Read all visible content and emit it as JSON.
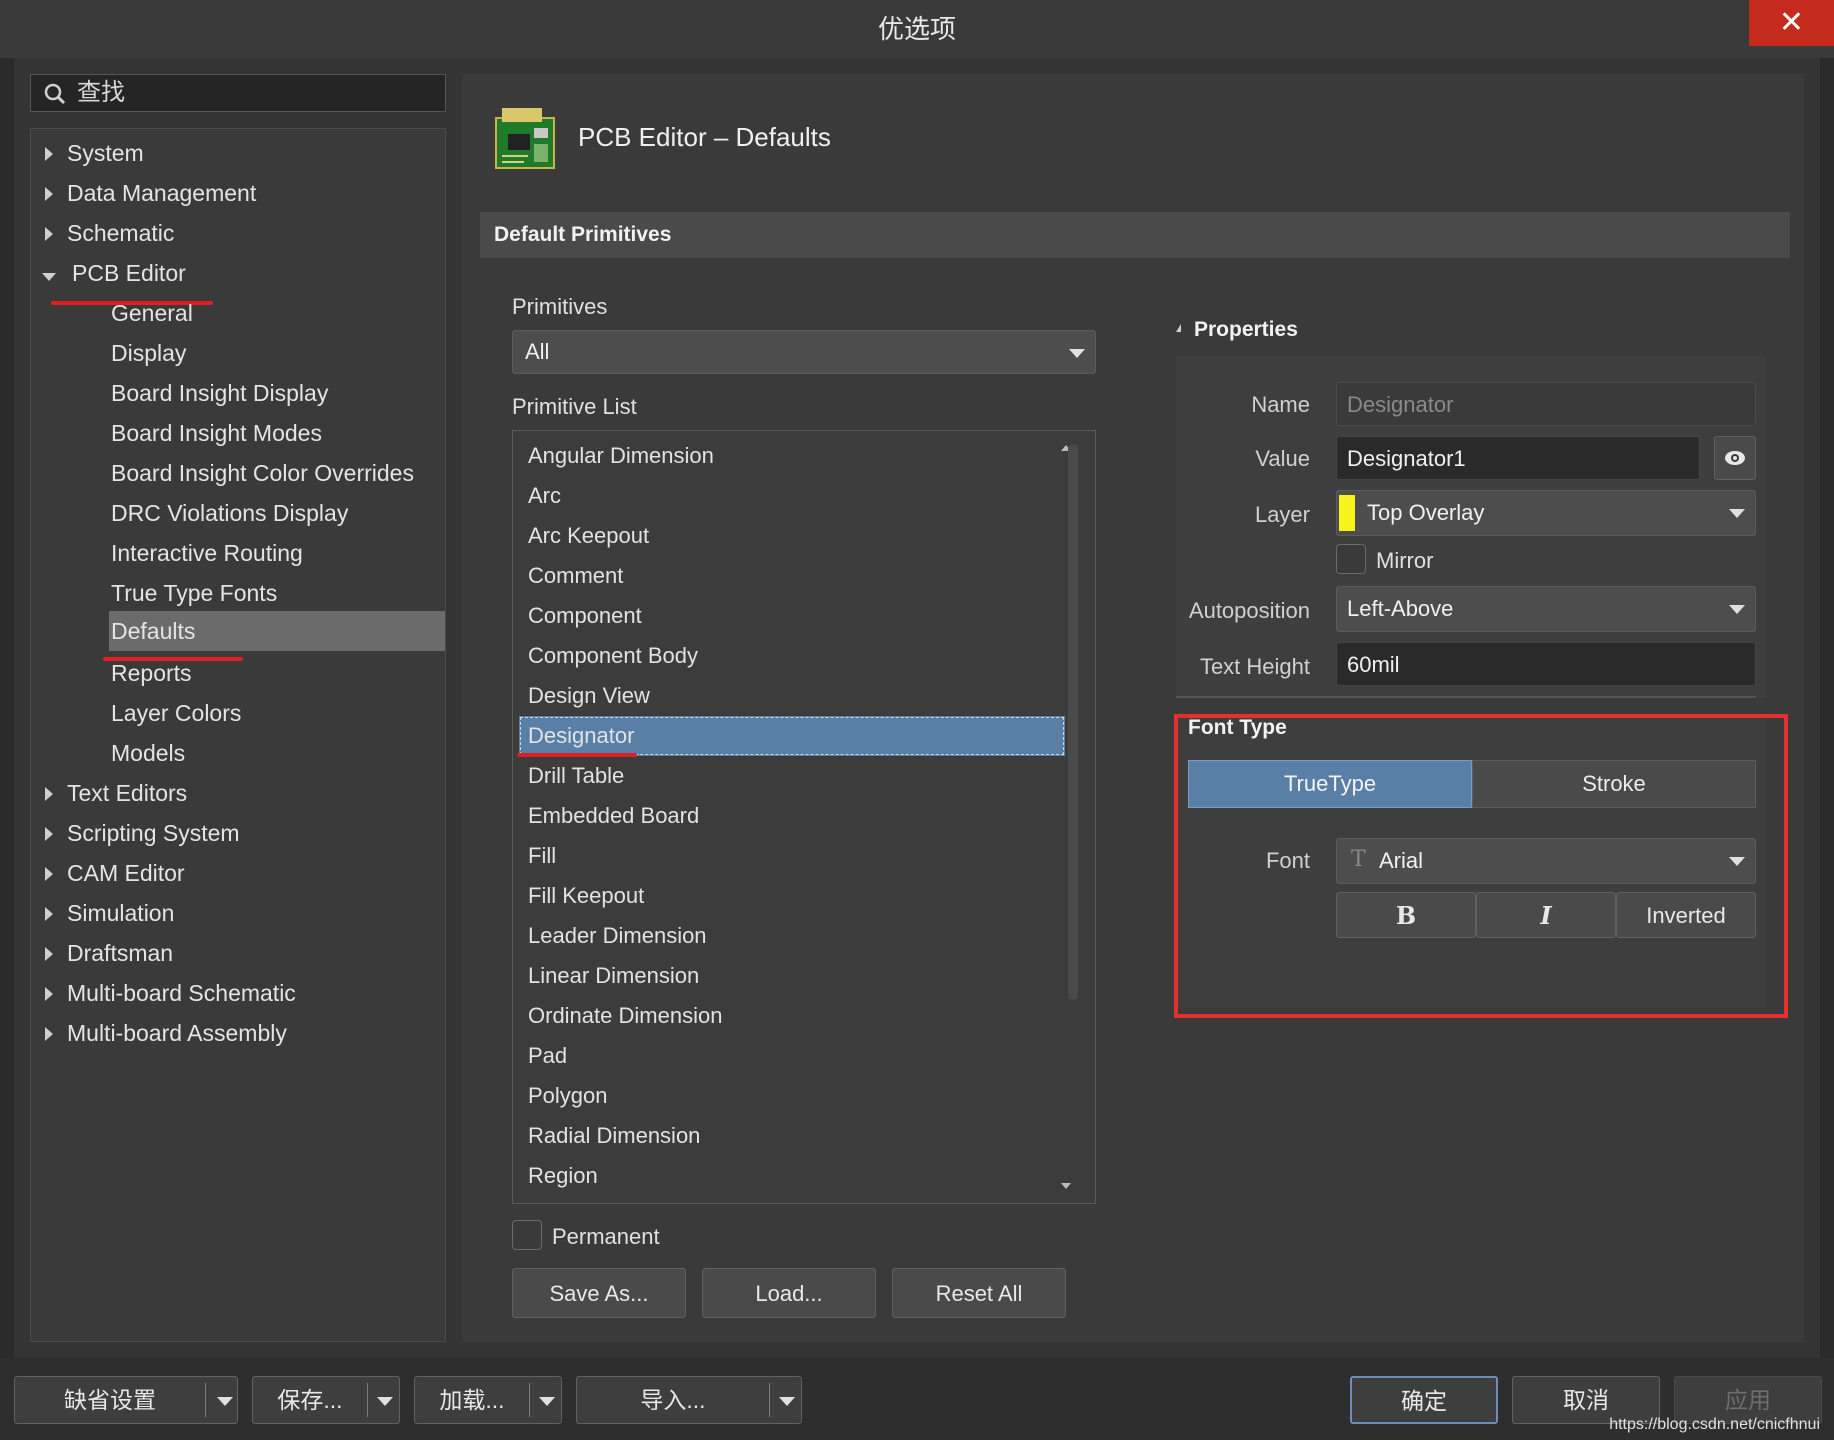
{
  "window": {
    "title": "优选项",
    "close_glyph": "✕"
  },
  "search": {
    "placeholder": "查找",
    "icon": "search-icon"
  },
  "tree": {
    "items": [
      {
        "label": "System"
      },
      {
        "label": "Data Management"
      },
      {
        "label": "Schematic"
      },
      {
        "label": "PCB Editor"
      },
      {
        "label": "General"
      },
      {
        "label": "Display"
      },
      {
        "label": "Board Insight Display"
      },
      {
        "label": "Board Insight Modes"
      },
      {
        "label": "Board Insight Color Overrides"
      },
      {
        "label": "DRC Violations Display"
      },
      {
        "label": "Interactive Routing"
      },
      {
        "label": "True Type Fonts"
      },
      {
        "label": "Defaults"
      },
      {
        "label": "Reports"
      },
      {
        "label": "Layer Colors"
      },
      {
        "label": "Models"
      },
      {
        "label": "Text Editors"
      },
      {
        "label": "Scripting System"
      },
      {
        "label": "CAM Editor"
      },
      {
        "label": "Simulation"
      },
      {
        "label": "Draftsman"
      },
      {
        "label": "Multi-board Schematic"
      },
      {
        "label": "Multi-board Assembly"
      }
    ]
  },
  "header": {
    "title": "PCB Editor – Defaults",
    "icon": "pcb-board-icon"
  },
  "section": {
    "title": "Default Primitives"
  },
  "primitives": {
    "label": "Primitives",
    "selected": "All",
    "list_label": "Primitive List",
    "items": [
      "Angular Dimension",
      "Arc",
      "Arc Keepout",
      "Comment",
      "Component",
      "Component Body",
      "Design View",
      "Designator",
      "Drill Table",
      "Embedded Board",
      "Fill",
      "Fill Keepout",
      "Leader Dimension",
      "Linear Dimension",
      "Ordinate Dimension",
      "Pad",
      "Polygon",
      "Radial Dimension",
      "Region"
    ],
    "selected_item": "Designator",
    "permanent_label": "Permanent",
    "save_as": "Save As...",
    "load": "Load...",
    "reset_all": "Reset All"
  },
  "properties": {
    "title": "Properties",
    "name_label": "Name",
    "name_value": "Designator",
    "value_label": "Value",
    "value_value": "Designator1",
    "layer_label": "Layer",
    "layer_value": "Top Overlay",
    "layer_color": "#f5f51a",
    "mirror_label": "Mirror",
    "autoposition_label": "Autoposition",
    "autoposition_value": "Left-Above",
    "text_height_label": "Text Height",
    "text_height_value": "60mil"
  },
  "font_type": {
    "title": "Font Type",
    "truetype": "TrueType",
    "stroke": "Stroke",
    "font_label": "Font",
    "font_value": "Arial",
    "bold": "B",
    "italic": "I",
    "inverted": "Inverted"
  },
  "footer": {
    "defaults_btn": "缺省设置",
    "save_btn": "保存...",
    "load_btn": "加载...",
    "import_btn": "导入...",
    "ok_btn": "确定",
    "cancel_btn": "取消",
    "apply_btn": "应用"
  },
  "watermark": "https://blog.csdn.net/cnicfhnui",
  "colors": {
    "accent": "#5a7fa6",
    "highlight_red": "#e53030",
    "close_red": "#c42b1c"
  }
}
